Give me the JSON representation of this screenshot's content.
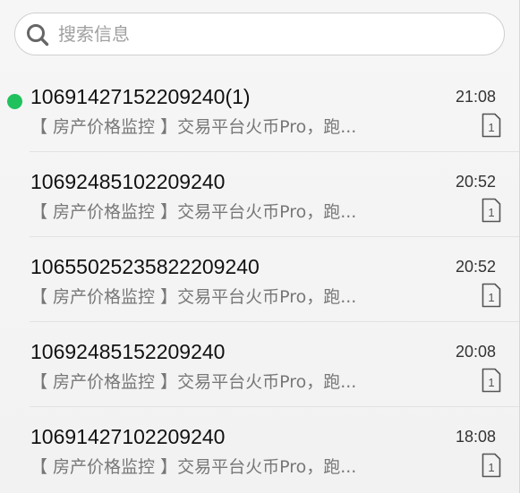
{
  "search": {
    "placeholder": "搜索信息",
    "icon": "search-icon"
  },
  "messages": [
    {
      "sender": "10691427152209240(1)",
      "preview": "【 房产价格监控 】交易平台火币Pro，跑...",
      "time": "21:08",
      "unread": true,
      "sim": "1"
    },
    {
      "sender": "10692485102209240",
      "preview": "【 房产价格监控 】交易平台火币Pro，跑...",
      "time": "20:52",
      "unread": false,
      "sim": "1"
    },
    {
      "sender": "10655025235822209240",
      "preview": "【 房产价格监控 】交易平台火币Pro，跑...",
      "time": "20:52",
      "unread": false,
      "sim": "1"
    },
    {
      "sender": "10692485152209240",
      "preview": "【 房产价格监控 】交易平台火币Pro，跑...",
      "time": "20:08",
      "unread": false,
      "sim": "1"
    },
    {
      "sender": "10691427102209240",
      "preview": "【 房产价格监控 】交易平台火币Pro，跑...",
      "time": "18:08",
      "unread": false,
      "sim": "1"
    }
  ],
  "colors": {
    "unread_dot": "#21c25e"
  }
}
